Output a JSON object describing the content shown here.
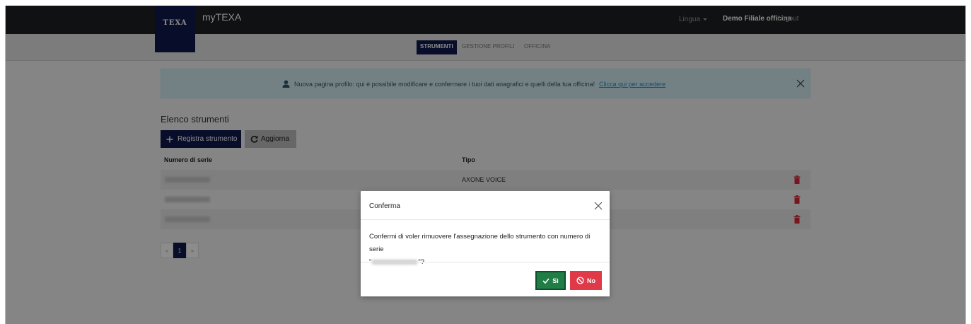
{
  "header": {
    "logo_text": "TEXA",
    "app_title": "myTEXA",
    "language_label": "Lingua",
    "user_name": "Demo Filiale officina",
    "logout_label": "Logout"
  },
  "subnav": {
    "tabs": [
      {
        "label": "STRUMENTI",
        "active": true
      },
      {
        "label": "GESTIONE PROFILI",
        "active": false
      },
      {
        "label": "OFFICINA",
        "active": false
      }
    ]
  },
  "alert": {
    "text": "Nuova pagina profilo: qui è possibile modificare e confermare i tuoi dati anagrafici e quelli della tua officina!",
    "link_text": "Clicca qui per accedere"
  },
  "main": {
    "title": "Elenco strumenti",
    "register_label": "Registra strumento",
    "refresh_label": "Aggiorna",
    "columns": [
      "Numero di serie",
      "Tipo"
    ],
    "rows": [
      {
        "type": "AXONE VOICE"
      },
      {
        "type": ""
      },
      {
        "type": ""
      }
    ]
  },
  "pagination": {
    "prev": "«",
    "current": "1",
    "next": "»"
  },
  "modal": {
    "title": "Conferma",
    "body_text": "Confermi di voler rimuovere l'assegnazione dello strumento con numero di serie",
    "quote_open": "\"",
    "quote_close": "\"?",
    "yes_label": "Sì",
    "no_label": "No"
  },
  "colors": {
    "brand_navy": "#0f1a4e",
    "topbar": "#1e1f22",
    "alert_bg": "#d3ecf1",
    "yes_green": "#1f7d45",
    "no_red": "#e03a48",
    "trash_red": "#d9283a"
  }
}
